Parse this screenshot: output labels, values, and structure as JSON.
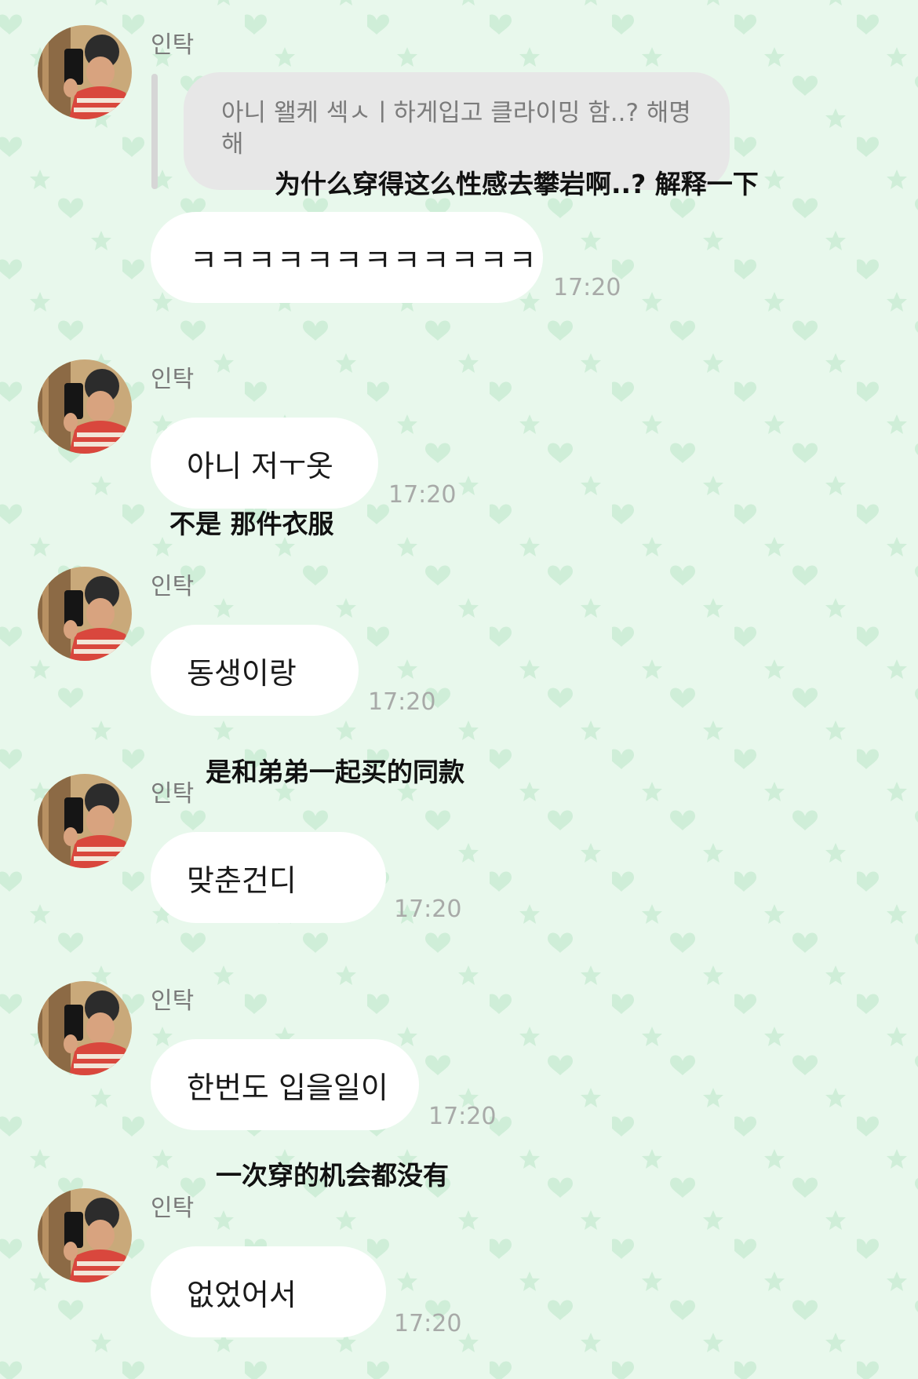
{
  "theme": {
    "background": "#e8f8ec",
    "pattern_color": "#cfeed8",
    "bubble": "#ffffff",
    "quote_bubble": "#e7e7e7",
    "timestamp": "#a8aaa8",
    "sender_name": "#7a7a7a"
  },
  "pattern_icons": [
    "heart-icon",
    "star-icon"
  ],
  "reply": {
    "quoted_text": "아니 왤케 섹ㅅㅣ하게입고 클라이밍 함..? 해명해",
    "translation": "为什么穿得这么性感去攀岩啊..? 解释一下"
  },
  "messages": [
    {
      "sender": "인탁",
      "text": "ㅋㅋㅋㅋㅋㅋㅋㅋㅋㅋㅋㅋ",
      "time": "17:20",
      "translation": ""
    },
    {
      "sender": "인탁",
      "text": "아니 저ㅜ옷",
      "time": "17:20",
      "translation": "不是 那件衣服"
    },
    {
      "sender": "인탁",
      "text": "동생이랑",
      "time": "17:20",
      "translation": "是和弟弟一起买的同款"
    },
    {
      "sender": "인탁",
      "text": "맞춘건디",
      "time": "17:20",
      "translation": ""
    },
    {
      "sender": "인탁",
      "text": "한번도 입을일이",
      "time": "17:20",
      "translation": "一次穿的机会都没有"
    },
    {
      "sender": "인탁",
      "text": "없었어서",
      "time": "17:20",
      "translation": ""
    }
  ]
}
